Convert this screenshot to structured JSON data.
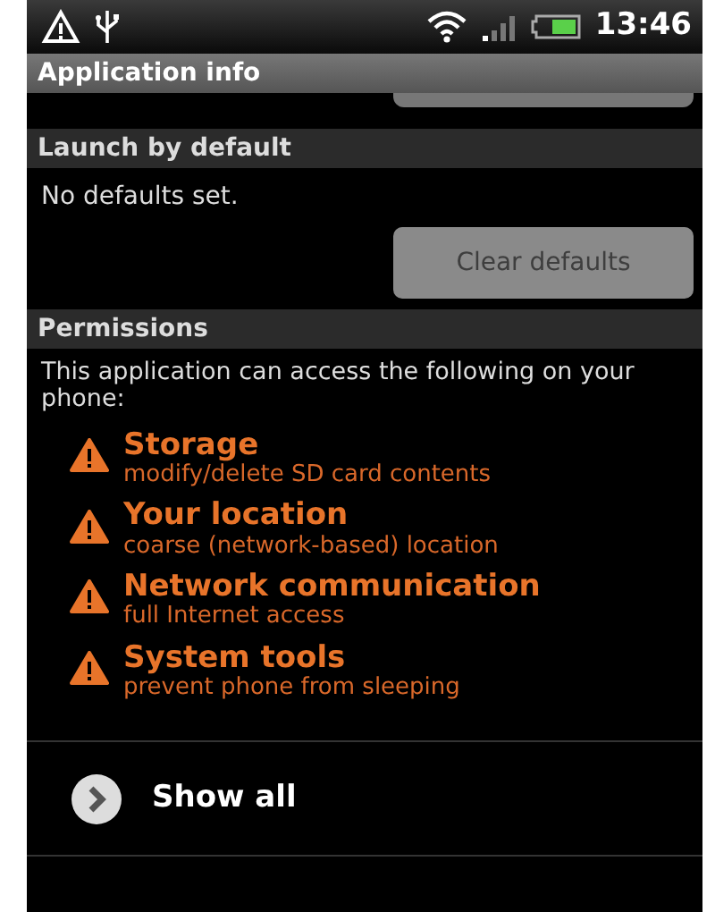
{
  "status_bar": {
    "time": "13:46"
  },
  "title_bar": {
    "title": "Application info"
  },
  "launch_by_default": {
    "header": "Launch by default",
    "message": "No defaults set.",
    "button": {
      "label": "Clear defaults",
      "disabled": true
    }
  },
  "permissions": {
    "header": "Permissions",
    "intro": "This application can access the following on your phone:",
    "items": [
      {
        "title": "Storage",
        "description": "modify/delete SD card contents"
      },
      {
        "title": "Your location",
        "description": "coarse (network-based) location"
      },
      {
        "title": "Network communication",
        "description": "full Internet access"
      },
      {
        "title": "System tools",
        "description": "prevent phone from sleeping"
      }
    ],
    "show_all": "Show all"
  }
}
